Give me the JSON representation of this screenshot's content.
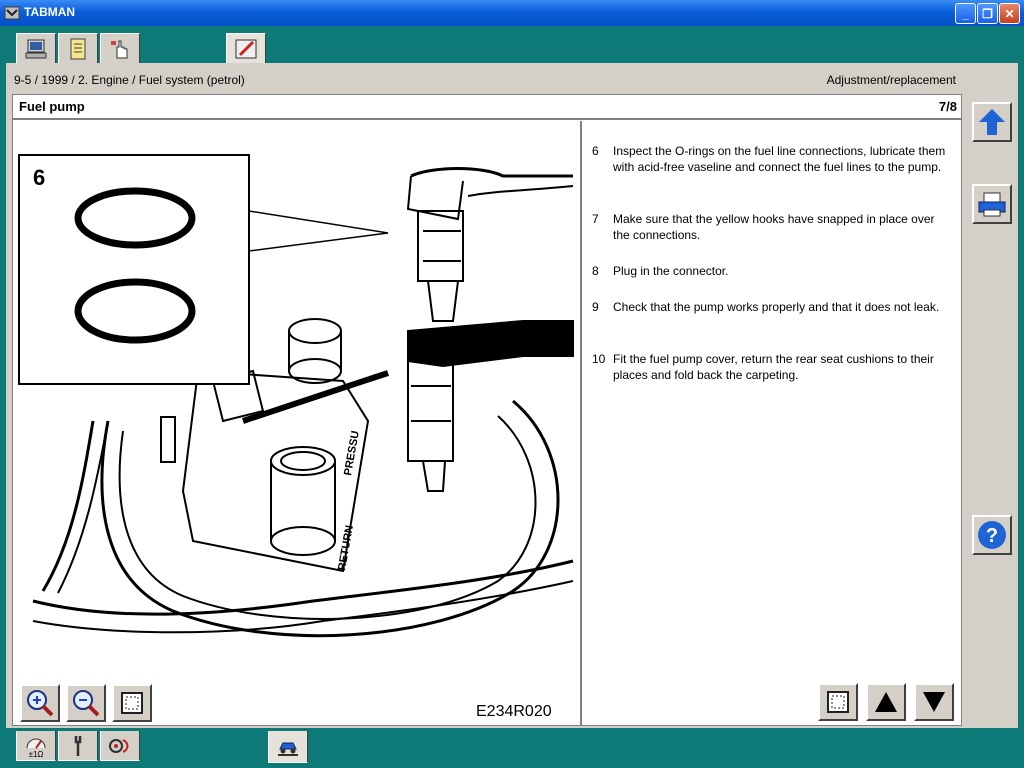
{
  "window": {
    "title": "TABMAN"
  },
  "breadcrumb": "9-5 / 1999 / 2. Engine / Fuel system (petrol)",
  "section": "Adjustment/replacement",
  "page": {
    "title": "Fuel pump",
    "counter": "7/8"
  },
  "figure": {
    "caption": "E234R020",
    "inset_label": "6",
    "labels": {
      "pressure": "PRESSU",
      "return": "RETURN"
    }
  },
  "steps": [
    {
      "num": "6",
      "text": "Inspect the O-rings on the fuel line connections, lubricate them with acid-free vaseline and connect the fuel lines to the pump."
    },
    {
      "num": "7",
      "text": "Make sure that the yellow hooks have snapped in place over the connections."
    },
    {
      "num": "8",
      "text": "Plug in the connector."
    },
    {
      "num": "9",
      "text": "Check that the pump works properly and that it does not leak."
    },
    {
      "num": "10",
      "text": "Fit the fuel pump cover, return the rear seat cushions to their places and fold back the carpeting."
    }
  ],
  "icons": {
    "top_tabs": [
      "computer-icon",
      "document-list-icon",
      "hand-pointer-icon",
      "pen-icon"
    ],
    "bottom_tabs": [
      "multimeter-icon",
      "wrench-icon",
      "sensor-icon",
      "car-lift-icon"
    ],
    "zoom": [
      "zoom-in-icon",
      "zoom-out-icon",
      "fit-page-icon"
    ],
    "nav": [
      "fit-text-icon",
      "arrow-up-icon",
      "arrow-down-icon"
    ],
    "side": [
      "up-arrow-icon",
      "printer-icon",
      "help-icon"
    ]
  },
  "colors": {
    "background": "#0d7a78",
    "titlebar": "#0a5fd8",
    "accent_blue": "#1e64d6"
  }
}
